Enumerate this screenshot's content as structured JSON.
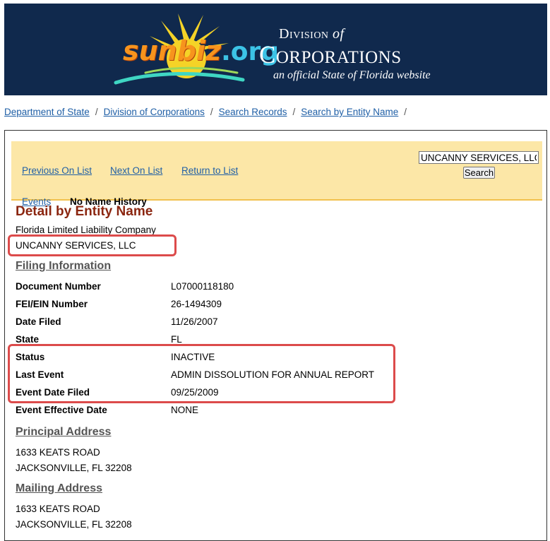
{
  "header": {
    "logo_sunbiz": "sunbiz",
    "logo_org": ".org",
    "division_line1": "Division",
    "division_of": "of",
    "division_line2": "Corporations",
    "tagline": "an official State of Florida website"
  },
  "breadcrumb": [
    "Department of State",
    "Division of Corporations",
    "Search Records",
    "Search by Entity Name"
  ],
  "nav": {
    "previous": "Previous On List",
    "next": "Next On List",
    "return": "Return to List",
    "events": "Events",
    "no_name_history": "No Name History",
    "search_value": "UNCANNY SERVICES, LLC",
    "search_button": "Search"
  },
  "detail": {
    "title": "Detail by Entity Name",
    "entity_type": "Florida Limited Liability Company",
    "entity_name": "UNCANNY SERVICES, LLC"
  },
  "filing": {
    "heading": "Filing Information",
    "rows": [
      {
        "label": "Document Number",
        "value": "L07000118180"
      },
      {
        "label": "FEI/EIN Number",
        "value": "26-1494309"
      },
      {
        "label": "Date Filed",
        "value": "11/26/2007"
      },
      {
        "label": "State",
        "value": "FL"
      },
      {
        "label": "Status",
        "value": "INACTIVE"
      },
      {
        "label": "Last Event",
        "value": "ADMIN DISSOLUTION FOR ANNUAL REPORT"
      },
      {
        "label": "Event Date Filed",
        "value": "09/25/2009"
      },
      {
        "label": "Event Effective Date",
        "value": "NONE"
      }
    ]
  },
  "principal_address": {
    "heading": "Principal Address",
    "line1": "1633 KEATS ROAD",
    "line2": "JACKSONVILLE, FL 32208"
  },
  "mailing_address": {
    "heading": "Mailing Address",
    "line1": "1633 KEATS ROAD",
    "line2": "JACKSONVILLE, FL 32208"
  },
  "colors": {
    "banner": "#10294d",
    "link": "#1f5fa6",
    "title": "#8b2610",
    "navbar": "#fce7a7",
    "highlight": "#dc4b4b"
  }
}
